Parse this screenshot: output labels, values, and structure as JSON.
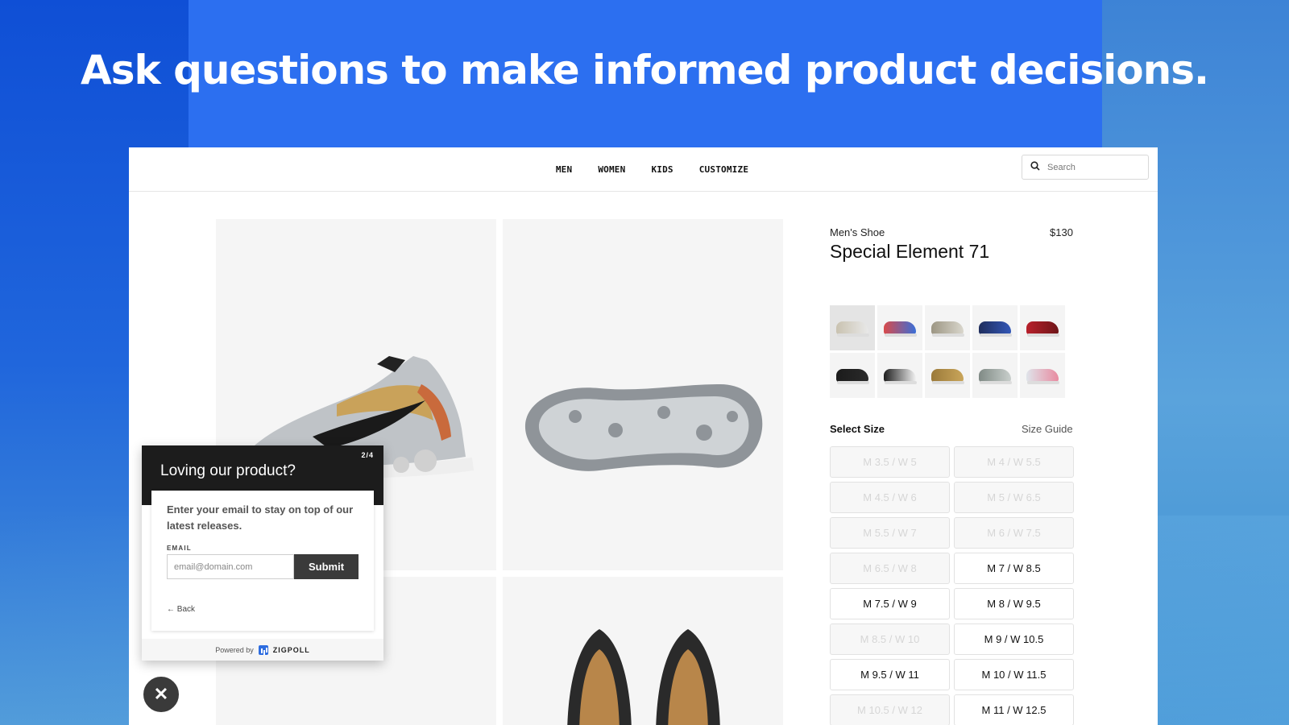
{
  "headline": "Ask questions to make informed product decisions.",
  "nav": {
    "items": [
      "MEN",
      "WOMEN",
      "KIDS",
      "CUSTOMIZE"
    ],
    "search_placeholder": "Search"
  },
  "product": {
    "category": "Men's Shoe",
    "price": "$130",
    "name": "Special Element 71",
    "swatch_colors": [
      [
        "#c9c2b0",
        "#e8e8e8"
      ],
      [
        "#d94a4a",
        "#3a6fd8"
      ],
      [
        "#9c9683",
        "#d9d6cc"
      ],
      [
        "#1f2d5c",
        "#3358b8"
      ],
      [
        "#b8202b",
        "#6e1518"
      ],
      [
        "#1b1b1b",
        "#2a2a2a"
      ],
      [
        "#1e1e1e",
        "#f2f2f2"
      ],
      [
        "#9b7a3a",
        "#c9a55a"
      ],
      [
        "#7f8a85",
        "#c9cfcc"
      ],
      [
        "#dfe4ea",
        "#e88aa0"
      ]
    ]
  },
  "sizes": {
    "title": "Select Size",
    "guide": "Size Guide",
    "options": [
      {
        "label": "M 3.5 / W 5",
        "available": false
      },
      {
        "label": "M 4 / W 5.5",
        "available": false
      },
      {
        "label": "M 4.5 / W 6",
        "available": false
      },
      {
        "label": "M 5 / W 6.5",
        "available": false
      },
      {
        "label": "M 5.5 / W 7",
        "available": false
      },
      {
        "label": "M 6 / W 7.5",
        "available": false
      },
      {
        "label": "M 6.5 / W 8",
        "available": false
      },
      {
        "label": "M 7 / W 8.5",
        "available": true
      },
      {
        "label": "M 7.5 / W 9",
        "available": true
      },
      {
        "label": "M 8 / W 9.5",
        "available": true
      },
      {
        "label": "M 8.5 / W 10",
        "available": false
      },
      {
        "label": "M 9 / W 10.5",
        "available": true
      },
      {
        "label": "M 9.5 / W 11",
        "available": true
      },
      {
        "label": "M 10 / W 11.5",
        "available": true
      },
      {
        "label": "M 10.5 / W 12",
        "available": false
      },
      {
        "label": "M 11 / W 12.5",
        "available": true
      }
    ]
  },
  "survey": {
    "step": "2/4",
    "title": "Loving our product?",
    "question": "Enter your email to stay on top of our latest releases.",
    "email_label": "EMAIL",
    "email_placeholder": "email@domain.com",
    "submit": "Submit",
    "back": "← Back",
    "powered_by": "Powered by",
    "brand": "ZIGPOLL"
  },
  "close_symbol": "✕"
}
